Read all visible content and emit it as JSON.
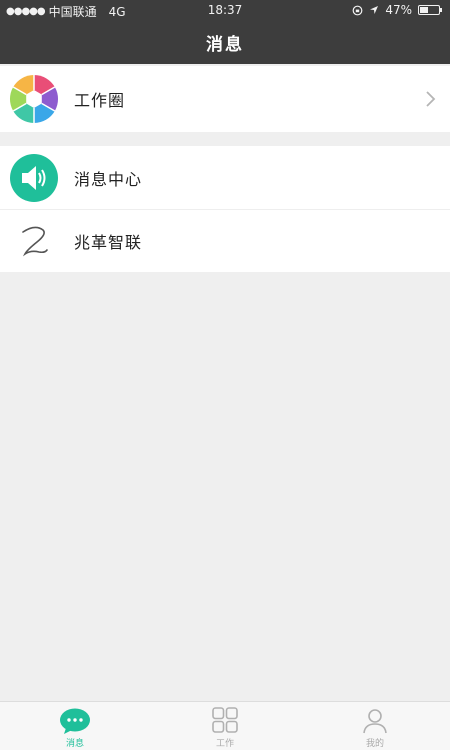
{
  "status_bar": {
    "carrier": "中国联通",
    "network": "4G",
    "time": "18:37",
    "battery": "47%",
    "battery_level": 0.47
  },
  "header": {
    "title": "消息"
  },
  "list": {
    "work_circle": {
      "label": "工作圈",
      "icon": "aperture-icon"
    },
    "message_center": {
      "label": "消息中心",
      "icon": "speaker-icon"
    },
    "zhaoge_zhilian": {
      "label": "兆革智联",
      "icon": "signature-logo-icon"
    }
  },
  "tabs": [
    {
      "label": "消息",
      "icon": "chat-bubble-icon",
      "active": true
    },
    {
      "label": "工作",
      "icon": "grid-icon",
      "active": false
    },
    {
      "label": "我的",
      "icon": "person-icon",
      "active": false
    }
  ],
  "colors": {
    "header_bg": "#3d3d3d",
    "accent": "#1fbf9a",
    "background": "#efefef"
  }
}
